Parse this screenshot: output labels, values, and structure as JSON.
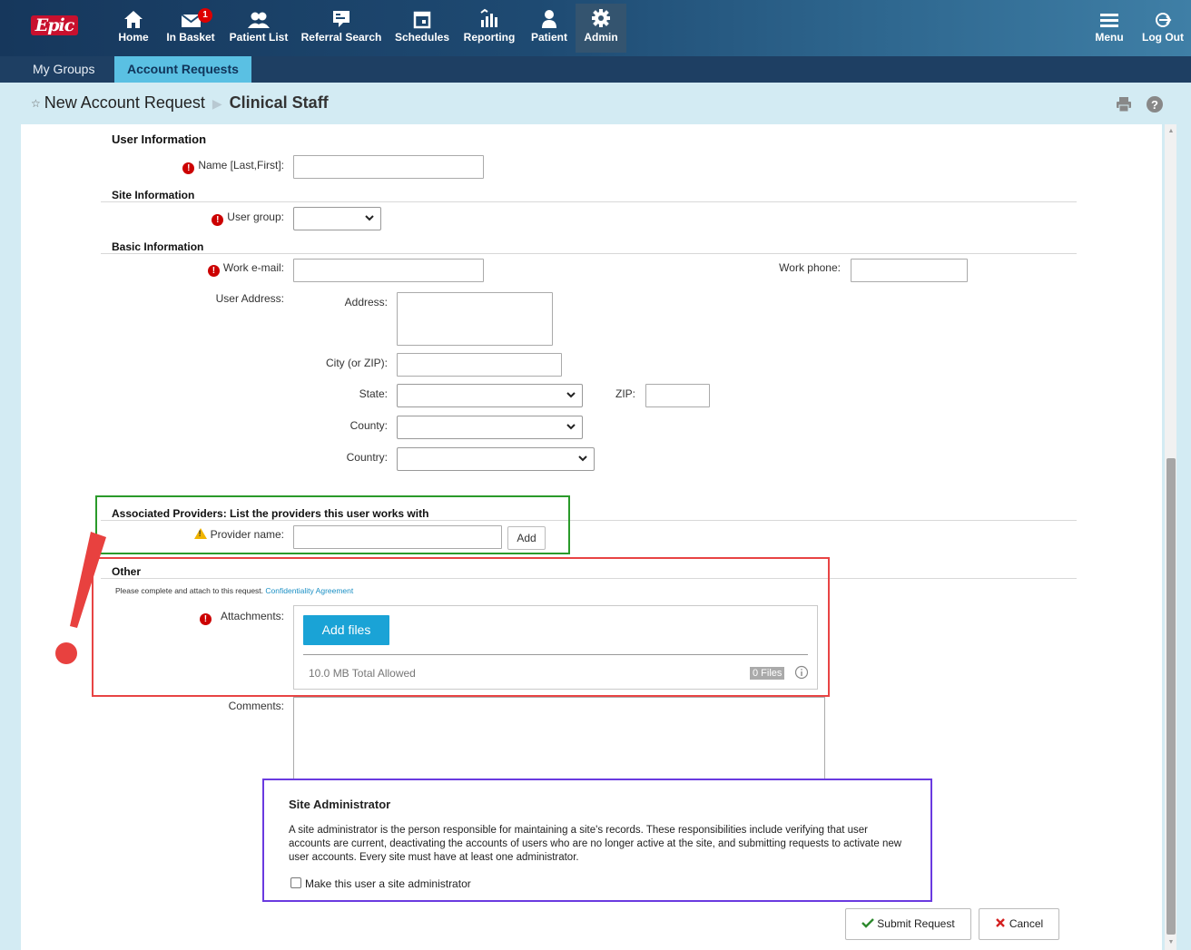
{
  "nav": {
    "logo": "Epic",
    "items": [
      {
        "label": "Home"
      },
      {
        "label": "In Basket",
        "badge": "1"
      },
      {
        "label": "Patient List"
      },
      {
        "label": "Referral Search"
      },
      {
        "label": "Schedules"
      },
      {
        "label": "Reporting"
      },
      {
        "label": "Patient"
      },
      {
        "label": "Admin"
      }
    ],
    "right": [
      {
        "label": "Menu"
      },
      {
        "label": "Log Out"
      }
    ]
  },
  "tabs": [
    {
      "label": "My Groups"
    },
    {
      "label": "Account Requests"
    }
  ],
  "breadcrumb": {
    "root": "New Account Request",
    "current": "Clinical Staff"
  },
  "form": {
    "user_info": {
      "title": "User Information",
      "name_label": "Name [Last,First]:"
    },
    "site_info": {
      "title": "Site Information",
      "user_group_label": "User group:"
    },
    "basic_info": {
      "title": "Basic Information",
      "work_email_label": "Work e-mail:",
      "work_phone_label": "Work phone:",
      "user_address_label": "User Address:",
      "address_label": "Address:",
      "city_label": "City (or ZIP):",
      "state_label": "State:",
      "zip_label": "ZIP:",
      "county_label": "County:",
      "country_label": "Country:"
    },
    "providers": {
      "title": "Associated Providers: List the providers this user works with",
      "provider_name_label": "Provider name:",
      "add_label": "Add"
    },
    "other": {
      "title": "Other",
      "note": "Please complete and attach to this request.",
      "note_link": "Confidentiality Agreement",
      "attachments_label": "Attachments:",
      "add_files_label": "Add files",
      "limit_text": "10.0 MB Total Allowed",
      "file_count": "0 Files",
      "comments_label": "Comments:"
    },
    "site_admin": {
      "title": "Site Administrator",
      "description": "A site administrator is the person responsible for maintaining a site's records. These responsibilities include verifying that user accounts are current, deactivating the accounts of users who are no longer active at the site, and submitting requests to activate new user accounts. Every site must have at least one administrator.",
      "checkbox_label": "Make this user a site administrator"
    },
    "actions": {
      "submit_label": "Submit Request",
      "cancel_label": "Cancel"
    }
  },
  "colors": {
    "nav_dark": "#16375c",
    "tab_active": "#5ac0e3",
    "title_band": "#d3ebf3",
    "required": "#cc0000",
    "add_files": "#1aa3d6",
    "annot_green": "#2a9a2a",
    "annot_red": "#e84444",
    "annot_purple": "#6a3ae0"
  },
  "icons": [
    "home-icon",
    "mail-icon",
    "users-icon",
    "referral-icon",
    "calendar-icon",
    "reporting-icon",
    "patient-icon",
    "gear-icon",
    "hamburger-icon",
    "logout-icon",
    "print-icon",
    "help-icon",
    "chevron-down-icon",
    "info-icon",
    "checkmark-icon",
    "x-icon"
  ]
}
